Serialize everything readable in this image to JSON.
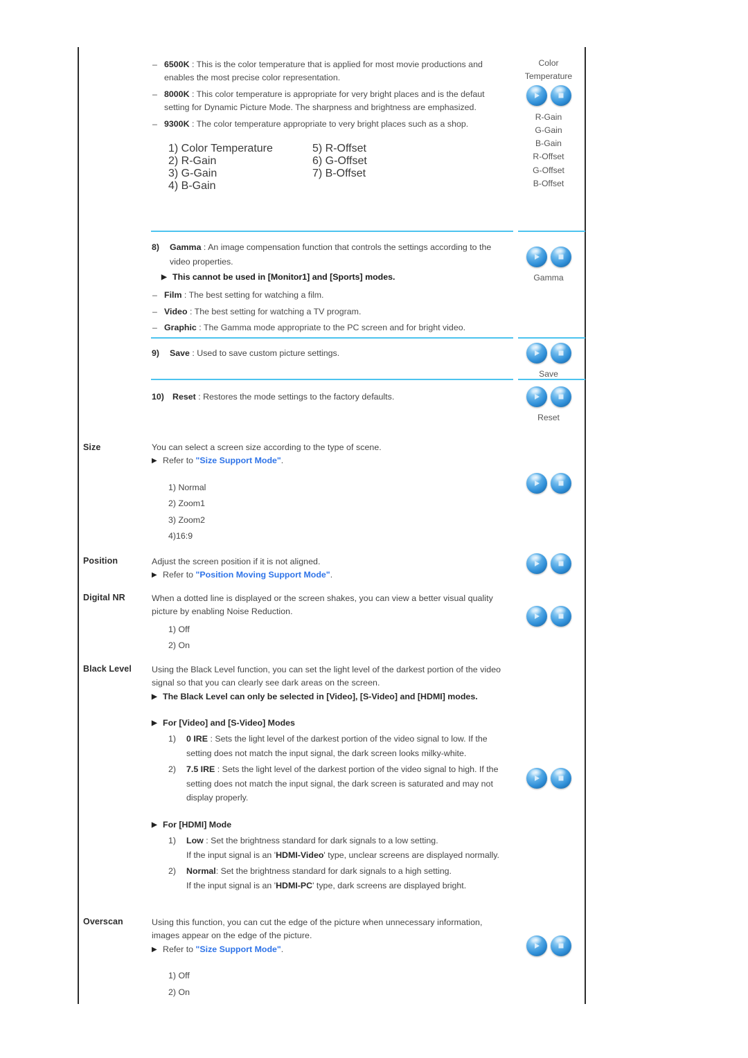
{
  "colors": {
    "separator": "#4cc3ef",
    "link": "#2f74e8",
    "border": "#2b2b2b",
    "orb_blue": "#2f8fd8"
  },
  "section_color_temp": {
    "bullets": [
      {
        "dash": "–",
        "term": "6500K",
        "colon": " : ",
        "text": "This is the color temperature that is applied for most movie productions and enables the most precise color representation."
      },
      {
        "dash": "–",
        "term": "8000K",
        "colon": " : ",
        "text": "This color temperature is appropriate for very bright places and is the defaut setting for Dynamic Picture Mode. The sharpness and brightness are emphasized."
      },
      {
        "dash": "–",
        "term": "9300K",
        "colon": " : ",
        "text": "The color temperature appropriate to very bright places such as a shop."
      }
    ],
    "option_col_a": [
      "1) Color Temperature",
      "2) R-Gain",
      "3) G-Gain",
      "4) B-Gain"
    ],
    "option_col_b": [
      "5) R-Offset",
      "6) G-Offset",
      "7) B-Offset"
    ],
    "icon_labels_above": [
      "Color",
      "Temperature"
    ],
    "icon_labels_below": [
      "R-Gain",
      "G-Gain",
      "B-Gain",
      "R-Offset",
      "G-Offset",
      "B-Offset"
    ]
  },
  "section_gamma": {
    "intro_num": "8) ",
    "intro_term": "Gamma",
    "intro_text": " : An image compensation function that controls the settings according to the video properties.",
    "note": "This cannot be used in [Monitor1] and [Sports] modes.",
    "bullets": [
      {
        "dash": "–",
        "term": "Film",
        "text": " : The best setting for watching a film."
      },
      {
        "dash": "–",
        "term": "Video",
        "text": " : The best setting for watching a TV program."
      },
      {
        "dash": "–",
        "term": "Graphic",
        "text": " : The Gamma mode appropriate to the PC screen and for bright video."
      }
    ],
    "icon_label": "Gamma"
  },
  "section_save": {
    "num": "9) ",
    "term": "Save",
    "text": " : Used to save custom picture settings.",
    "icon_label": "Save"
  },
  "section_reset": {
    "num": "10) ",
    "term": "Reset",
    "text": " : Restores the mode settings to the factory defaults.",
    "icon_label": "Reset"
  },
  "section_size": {
    "label": "Size",
    "desc": "You can select a screen size according to the type of scene.",
    "refer_prefix": "Refer to ",
    "refer_link": "\"Size Support Mode\"",
    "refer_suffix": ".",
    "options": [
      "1) Normal",
      "2) Zoom1",
      "3) Zoom2",
      "4)16:9"
    ]
  },
  "section_position": {
    "label": "Position",
    "desc": "Adjust the screen position if it is not aligned.",
    "refer_prefix": "Refer to ",
    "refer_link": "\"Position Moving Support Mode\"",
    "refer_suffix": "."
  },
  "section_digital_nr": {
    "label": "Digital NR",
    "desc": "When a dotted line is displayed or the screen shakes, you can view a better visual quality picture by enabling Noise Reduction.",
    "options": [
      "1) Off",
      "2) On"
    ]
  },
  "section_black_level": {
    "label": "Black Level",
    "desc": "Using the Black Level function, you can set the light level of the darkest portion of the video signal so that you can clearly see dark areas on the screen.",
    "note": "The Black Level can only be selected in [Video], [S-Video] and [HDMI] modes.",
    "group_video_heading": "For [Video] and [S-Video] Modes",
    "group_video_items": [
      {
        "num": "1)",
        "term": " 0 IRE",
        "text": " : Sets the light level of the darkest portion of the video signal to low. If the setting does not match the input signal, the dark screen looks milky-white."
      },
      {
        "num": "2)",
        "term": " 7.5 IRE",
        "text": " : Sets the light level of the darkest portion of the video signal to high. If the setting does not match the input signal, the dark screen is saturated and may not display properly."
      }
    ],
    "group_hdmi_heading": "For [HDMI] Mode",
    "group_hdmi_items": [
      {
        "num": "1)",
        "term": " Low",
        "text": " : Set the brightness standard for dark signals to a low setting.",
        "sub_prefix": "If the input signal is an '",
        "sub_bold": "HDMI-Video",
        "sub_suffix": "' type, unclear screens are displayed normally."
      },
      {
        "num": "2)",
        "term": " Normal",
        "text": ": Set the brightness standard for dark signals to a high setting.",
        "sub_prefix": "If the input signal is an '",
        "sub_bold": "HDMI-PC",
        "sub_suffix": "' type, dark screens are displayed bright."
      }
    ]
  },
  "section_overscan": {
    "label": "Overscan",
    "desc": "Using this function, you can cut the edge of the picture when unnecessary information, images appear on the edge of the picture.",
    "refer_prefix": "Refer to ",
    "refer_link": "\"Size Support Mode\"",
    "refer_suffix": ".",
    "options": [
      "1) Off",
      "2) On"
    ]
  },
  "icons": {
    "play_orb": "play-orb-icon",
    "stop_orb": "stop-orb-icon"
  }
}
